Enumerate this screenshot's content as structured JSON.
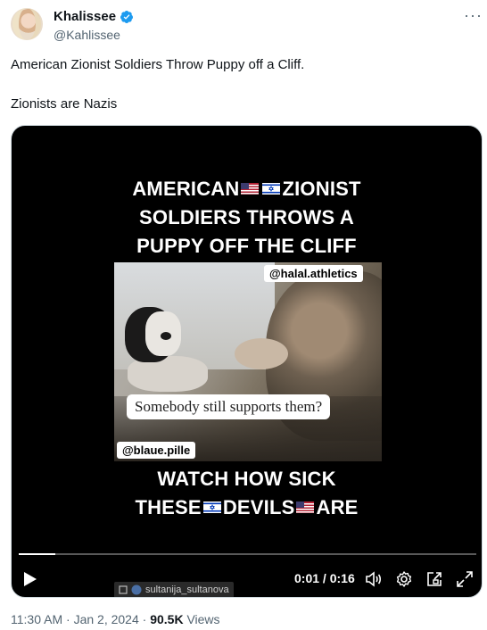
{
  "author": {
    "display_name": "Khalissee",
    "handle": "@Kahlissee",
    "verified_icon": "verified-badge-icon"
  },
  "more_label": "···",
  "tweet": {
    "line1": "American Zionist Soldiers Throw Puppy off a Cliff.",
    "line2": "Zionists are Nazis"
  },
  "video": {
    "caption_top": [
      "AMERICAN",
      "ZIONIST",
      "SOLDIERS THROWS A",
      "PUPPY OFF THE CLIFF"
    ],
    "caption_bottom": [
      "WATCH HOW SICK",
      "THESE",
      "DEVILS",
      "ARE"
    ],
    "tag_top": "@halal.athletics",
    "tag_bottom": "@blaue.pille",
    "speech": "Somebody still supports them?",
    "current_time": "0:01",
    "separator": "/",
    "duration": "0:16",
    "progress": 0.08,
    "repost_watermark": "sultanija_sultanova",
    "controls": [
      "play-icon",
      "volume-icon",
      "settings-icon",
      "picture-in-picture-icon",
      "fullscreen-icon"
    ]
  },
  "meta": {
    "time": "11:30 AM",
    "date": "Jan 2, 2024",
    "views_count": "90.5K",
    "views_label": "Views"
  },
  "colors": {
    "verified": "#1d9bf0",
    "secondary_text": "#536471"
  }
}
